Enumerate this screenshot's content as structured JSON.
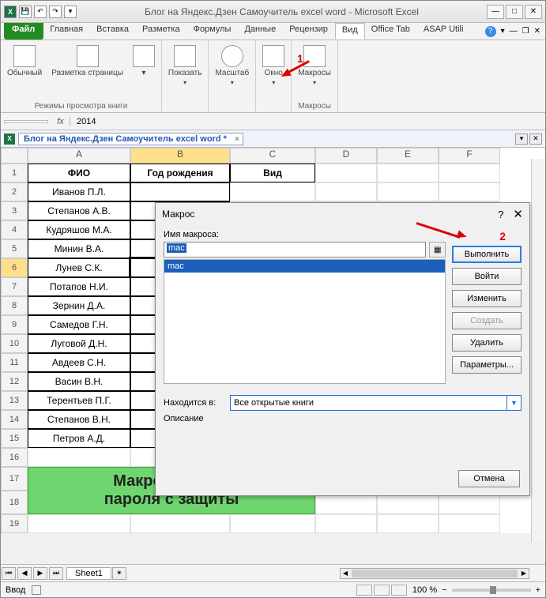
{
  "title": "Блог на Яндекс.Дзен Самоучитель excel word  -  Microsoft Excel",
  "tabs": {
    "file": "Файл",
    "home": "Главная",
    "insert": "Вставка",
    "layout": "Разметка",
    "formulas": "Формулы",
    "data": "Данные",
    "review": "Рецензир",
    "view": "Вид",
    "office": "Office Tab",
    "asap": "ASAP Utili"
  },
  "ribbon": {
    "normal": "Обычный",
    "page": "Разметка страницы",
    "group1": "Режимы просмотра книги",
    "show": "Показать",
    "zoom": "Масштаб",
    "window": "Окно",
    "macros": "Макросы",
    "group_macros": "Макросы"
  },
  "annot1": "1",
  "formula_value": "2014",
  "doctab": "Блог на Яндекс.Дзен Самоучитель excel word *",
  "cols": {
    "A": "A",
    "B": "B",
    "C": "C",
    "D": "D",
    "E": "E",
    "F": "F"
  },
  "headers": {
    "a": "ФИО",
    "b": "Год рождения",
    "c": "Вид"
  },
  "rows": [
    {
      "n": "1"
    },
    {
      "n": "2",
      "a": "Иванов П.Л."
    },
    {
      "n": "3",
      "a": "Степанов А.В."
    },
    {
      "n": "4",
      "a": "Кудряшов М.А."
    },
    {
      "n": "5",
      "a": "Минин В.А."
    },
    {
      "n": "6",
      "a": "Лунев С.К."
    },
    {
      "n": "7",
      "a": "Потапов Н.И."
    },
    {
      "n": "8",
      "a": "Зернин Д.А."
    },
    {
      "n": "9",
      "a": "Самедов Г.Н."
    },
    {
      "n": "10",
      "a": "Луговой Д.Н."
    },
    {
      "n": "11",
      "a": "Авдеев С.Н."
    },
    {
      "n": "12",
      "a": "Васин В.Н."
    },
    {
      "n": "13",
      "a": "Терентьев П.Г."
    },
    {
      "n": "14",
      "a": "Степанов В.Н."
    },
    {
      "n": "15",
      "a": "Петров А.Д."
    },
    {
      "n": "16"
    },
    {
      "n": "17"
    },
    {
      "n": "18"
    },
    {
      "n": "19"
    }
  ],
  "banner_l1": "Макрос снятия",
  "banner_l2": "пароля с защиты",
  "sheet": "Sheet1",
  "status": "Ввод",
  "zoom": "100 %",
  "dialog": {
    "title": "Макрос",
    "name_lbl": "Имя макроса:",
    "name_val": "mac",
    "list_item": "mac",
    "run": "Выполнить",
    "step": "Войти",
    "edit": "Изменить",
    "create": "Создать",
    "delete": "Удалить",
    "options": "Параметры...",
    "in_lbl": "Находится в:",
    "in_val": "Все открытые книги",
    "desc_lbl": "Описание",
    "cancel": "Отмена",
    "annot2": "2"
  }
}
